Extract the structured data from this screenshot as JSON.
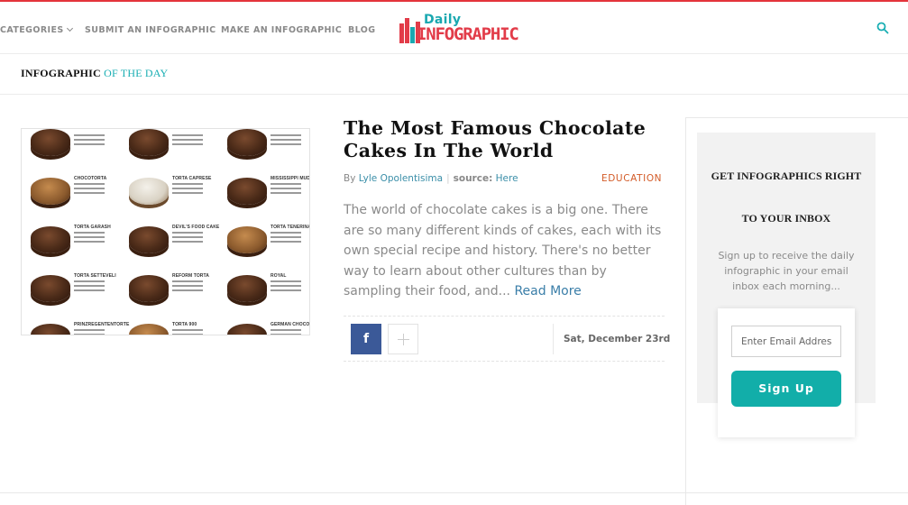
{
  "colors": {
    "brand_red": "#e4343b",
    "brand_teal": "#19aeb3",
    "link_blue": "#3a8ea8",
    "category_orange": "#d35b28",
    "facebook_blue": "#3b5998",
    "signup_teal": "#12aea9"
  },
  "nav": {
    "items": [
      {
        "label": "CATEGORIES",
        "icon": "chevron-down-icon"
      },
      {
        "label": "SUBMIT AN INFOGRAPHIC"
      },
      {
        "label": "MAKE AN INFOGRAPHIC"
      },
      {
        "label": "BLOG"
      }
    ],
    "logo": {
      "line1": "Daily",
      "line2": "INFOGRAPHIC"
    },
    "search_icon": "search-icon"
  },
  "section": {
    "title_main": "INFOGRAPHIC",
    "title_accent": "OF THE DAY"
  },
  "thumbnail": {
    "cakes": [
      {
        "name": ""
      },
      {
        "name": ""
      },
      {
        "name": ""
      },
      {
        "name": "CHOCOTORTA"
      },
      {
        "name": "TORTA CAPRESE"
      },
      {
        "name": "MISSISSIPPI MUD PIE"
      },
      {
        "name": "TORTA GARASH"
      },
      {
        "name": "DEVIL'S FOOD CAKE"
      },
      {
        "name": "TORTA TENERINA"
      },
      {
        "name": "TORTA SETTEVELI"
      },
      {
        "name": "REFORM TORTA"
      },
      {
        "name": "ROYAL"
      },
      {
        "name": "PRINZREGENTENTORTE"
      },
      {
        "name": "TORTA 900"
      },
      {
        "name": "GERMAN CHOCOLATE CAKE"
      }
    ]
  },
  "post": {
    "title": "The Most Famous Chocolate Cakes In The World",
    "by_label": "By",
    "author": "Lyle Opolentisima",
    "source_label": "source:",
    "source_link": "Here",
    "category": "EDUCATION",
    "excerpt": "The world of chocolate cakes is a big one. There are so many different kinds of cakes, each with its own special recipe and history. There's no better way to learn about other cultures than by sampling their food, and...",
    "read_more": "Read More",
    "date": "Sat, December 23rd",
    "facebook_icon": "f"
  },
  "sidebar": {
    "heading_line1": "GET INFOGRAPHICS RIGHT",
    "heading_line2": "TO YOUR INBOX",
    "text": "Sign up to receive the daily infographic in your email inbox each morning...",
    "email_placeholder": "Enter Email Address",
    "signup_label": "Sign Up"
  }
}
